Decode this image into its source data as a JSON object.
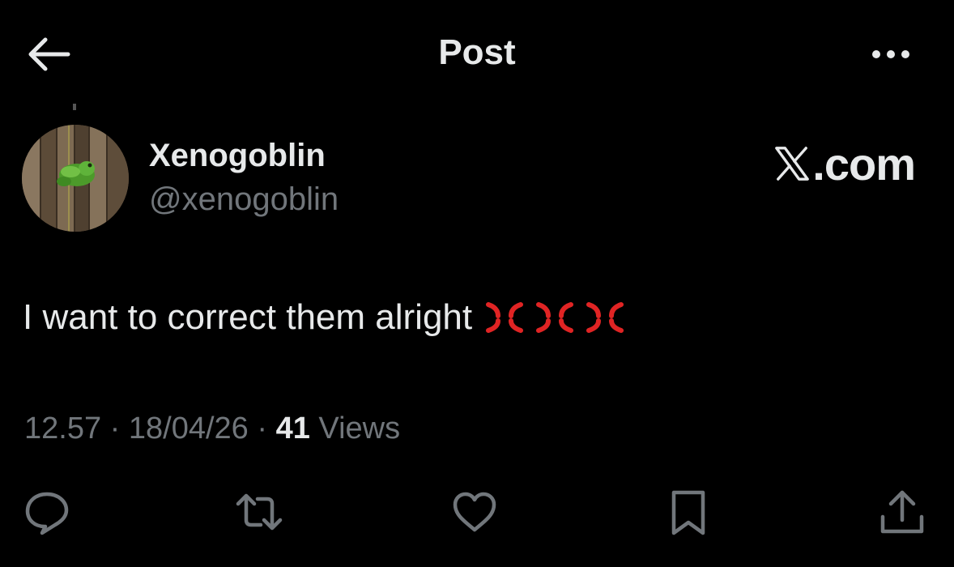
{
  "header": {
    "title": "Post",
    "back_icon": "arrow-left-icon",
    "more_icon": "more-horizontal-icon"
  },
  "author": {
    "display_name": "Xenogoblin",
    "handle": "@xenogoblin",
    "avatar_description": "green-frog-on-fence"
  },
  "brand": {
    "logo_icon": "x-logo-icon",
    "text": ".com"
  },
  "post": {
    "text": "I want to correct them alright",
    "emoji": [
      "anger-symbol",
      "anger-symbol",
      "anger-symbol"
    ]
  },
  "meta": {
    "time": "12.57",
    "date": "18/04/26",
    "separator": "·",
    "views_count": "41",
    "views_label": "Views"
  },
  "actions": {
    "reply_icon": "reply-icon",
    "repost_icon": "repost-icon",
    "like_icon": "heart-icon",
    "bookmark_icon": "bookmark-icon",
    "share_icon": "share-icon"
  },
  "colors": {
    "background": "#000000",
    "text_primary": "#e7e9ea",
    "text_secondary": "#71767b",
    "anger_emoji": "#e02424"
  }
}
